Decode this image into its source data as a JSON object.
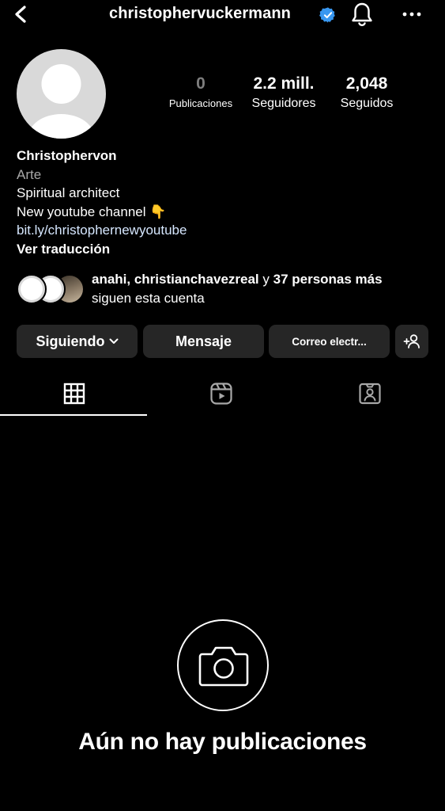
{
  "header": {
    "username": "christophervuckermann",
    "back_icon": "chevron-left-icon",
    "verified_icon": "verified-badge-icon",
    "notifications_icon": "bell-icon",
    "more_icon": "more-horizontal-icon",
    "verified_color": "#3897f0"
  },
  "stats": {
    "posts_value": "0",
    "posts_label": "Publicaciones",
    "followers_value": "2.2 mill.",
    "followers_label": "Seguidores",
    "following_value": "2,048",
    "following_label": "Seguidos"
  },
  "bio": {
    "name": "Christophervon",
    "category": "Arte",
    "line1": "Spiritual architect",
    "line2": "New youtube channel 👇",
    "link": "bit.ly/christophernewyoutube",
    "translate": "Ver traducción"
  },
  "followed_by": {
    "names": "anahi, christianchavezreal",
    "connector": " y ",
    "others": "37 personas más",
    "suffix": "siguen esta cuenta"
  },
  "buttons": {
    "following": "Siguiendo",
    "message": "Mensaje",
    "email": "Correo electr...",
    "add_user_icon": "add-person-icon"
  },
  "tabs": [
    {
      "icon": "grid-icon",
      "active": true
    },
    {
      "icon": "reels-icon",
      "active": false
    },
    {
      "icon": "tagged-icon",
      "active": false
    }
  ],
  "empty_state": {
    "icon": "camera-icon",
    "text": "Aún no hay publicaciones"
  }
}
